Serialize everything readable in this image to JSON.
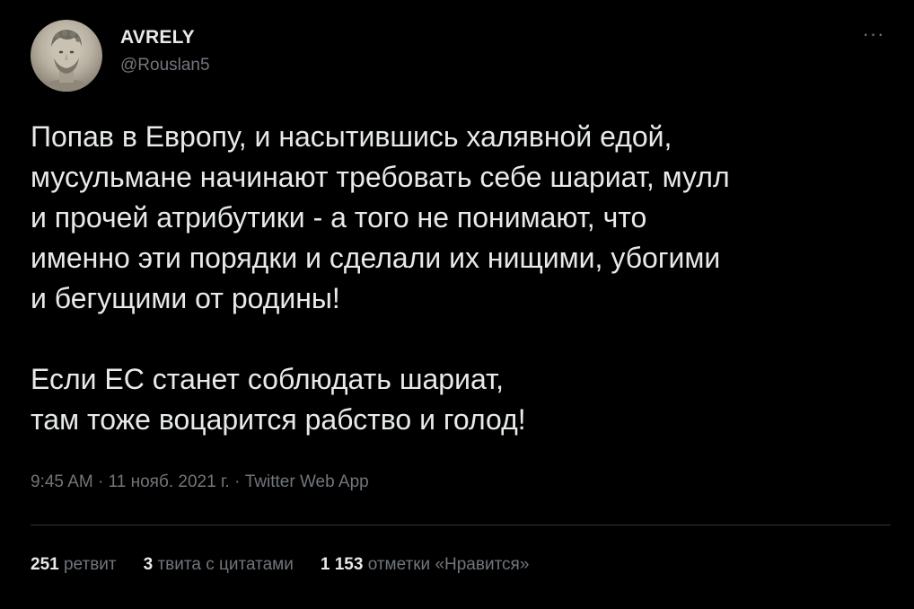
{
  "author": {
    "display_name": "AVRELY",
    "handle": "@Rouslan5",
    "avatar_icon": "marble-bust-avatar"
  },
  "menu": {
    "more_glyph": "···"
  },
  "tweet": {
    "lines": [
      "Попав в Европу, и насытившись халявной едой,",
      "мусульмане начинают требовать себе шариат, мулл",
      "и прочей атрибутики - а того не понимают, что",
      "именно эти порядки и сделали их нищими, убогими",
      "и бегущими от родины!",
      "",
      "Если ЕС станет соблюдать шариат,",
      "там тоже воцарится рабство и голод!"
    ]
  },
  "meta": {
    "time": "9:45 AM",
    "separator": " · ",
    "date": "11 нояб. 2021 г.",
    "source": "Twitter Web App"
  },
  "stats": {
    "retweets": {
      "count": "251",
      "label": "ретвит"
    },
    "quotes": {
      "count": "3",
      "label": "твита с цитатами"
    },
    "likes": {
      "count": "1 153",
      "label": "отметки «Нравится»"
    }
  },
  "colors": {
    "background": "#000000",
    "primary_text": "#e7e9ea",
    "secondary_text": "#71767b",
    "divider": "#2f3336"
  }
}
